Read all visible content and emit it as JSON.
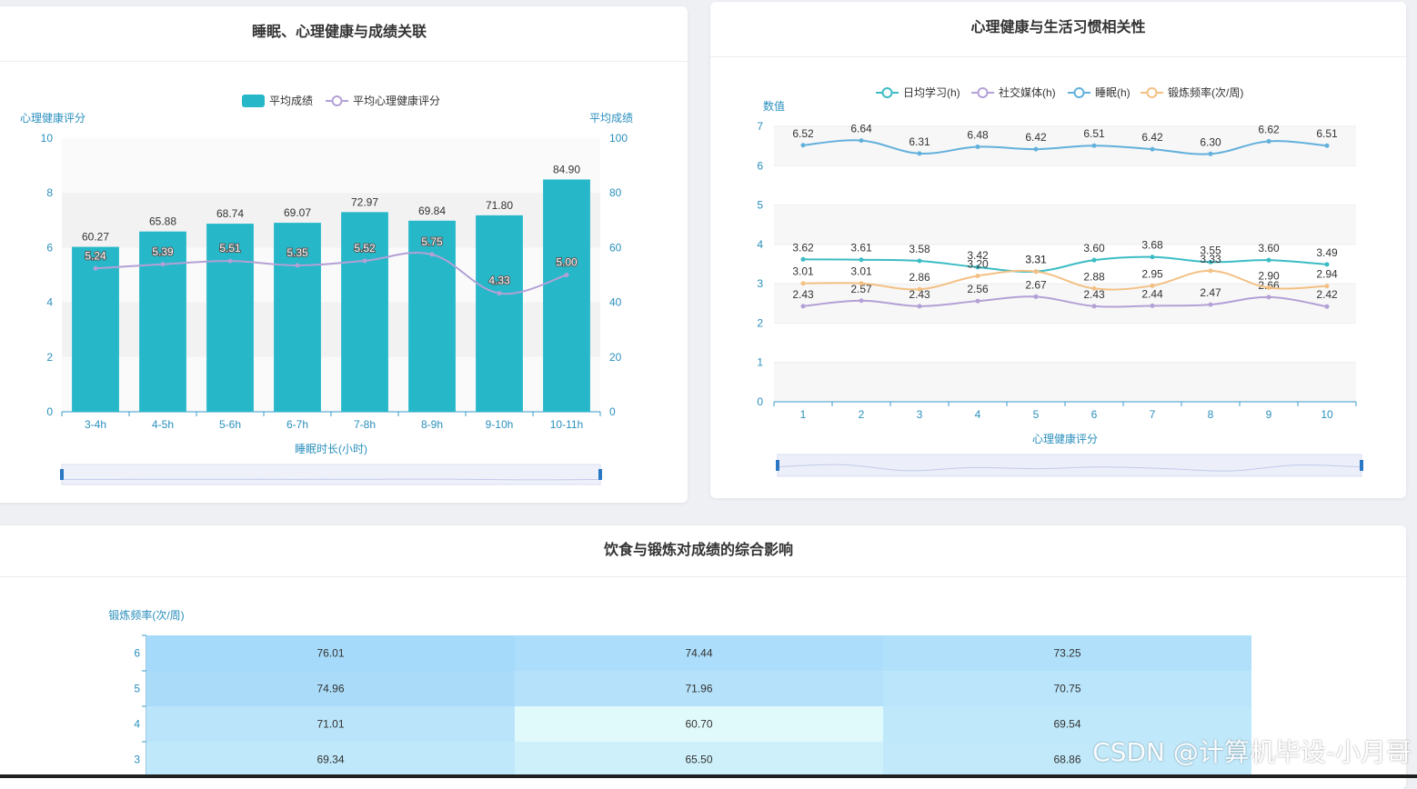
{
  "watermark": "CSDN @计算机毕设-小月哥",
  "chart_data": [
    {
      "type": "bar",
      "title": "睡眠、心理健康与成绩关联",
      "xlabel": "睡眠时长(小时)",
      "ylabel_left": "心理健康评分",
      "ylabel_right": "平均成绩",
      "categories": [
        "3-4h",
        "4-5h",
        "5-6h",
        "6-7h",
        "7-8h",
        "8-9h",
        "9-10h",
        "10-11h"
      ],
      "ylim_left": [
        0,
        10
      ],
      "ylim_right": [
        0,
        100
      ],
      "yticks_left": [
        "0",
        "2",
        "4",
        "6",
        "8",
        "10"
      ],
      "yticks_right": [
        "0",
        "20",
        "40",
        "60",
        "80",
        "100"
      ],
      "legend_position": "top-center",
      "series": [
        {
          "name": "平均成绩",
          "kind": "bar",
          "axis": "right",
          "color": "#26b8c9",
          "values": [
            60.27,
            65.88,
            68.74,
            69.07,
            72.97,
            69.84,
            71.8,
            84.9
          ],
          "labels": [
            "60.27",
            "65.88",
            "68.74",
            "69.07",
            "72.97",
            "69.84",
            "71.80",
            "84.90"
          ]
        },
        {
          "name": "平均心理健康评分",
          "kind": "line",
          "axis": "left",
          "color": "#b3a0d6",
          "values": [
            5.24,
            5.39,
            5.51,
            5.35,
            5.52,
            5.75,
            4.33,
            5.0
          ],
          "labels": [
            "5.24",
            "5.39",
            "5.51",
            "5.35",
            "5.52",
            "5.75",
            "4.33",
            "5.00"
          ]
        }
      ]
    },
    {
      "type": "line",
      "title": "心理健康与生活习惯相关性",
      "xlabel": "心理健康评分",
      "ylabel": "数值",
      "x": [
        "1",
        "2",
        "3",
        "4",
        "5",
        "6",
        "7",
        "8",
        "9",
        "10"
      ],
      "ylim": [
        0,
        7
      ],
      "yticks": [
        "0",
        "1",
        "2",
        "3",
        "4",
        "5",
        "6",
        "7"
      ],
      "legend_position": "top-center",
      "series": [
        {
          "name": "日均学习(h)",
          "color": "#3cbcc4",
          "values": [
            3.62,
            3.61,
            3.58,
            3.42,
            3.31,
            3.6,
            3.68,
            3.55,
            3.6,
            3.49
          ],
          "labels": [
            "3.62",
            "3.61",
            "3.58",
            "3.42",
            "3.31",
            "3.60",
            "3.68",
            "3.55",
            "3.60",
            "3.49"
          ]
        },
        {
          "name": "社交媒体(h)",
          "color": "#b3a0d6",
          "values": [
            2.43,
            2.57,
            2.43,
            2.56,
            2.67,
            2.43,
            2.44,
            2.47,
            2.66,
            2.42
          ],
          "labels": [
            "2.43",
            "2.57",
            "2.43",
            "2.56",
            "2.67",
            "2.43",
            "2.44",
            "2.47",
            "2.66",
            "2.42"
          ]
        },
        {
          "name": "睡眠(h)",
          "color": "#62b0dc",
          "values": [
            6.52,
            6.64,
            6.31,
            6.48,
            6.42,
            6.51,
            6.42,
            6.3,
            6.62,
            6.51
          ],
          "labels": [
            "6.52",
            "6.64",
            "6.31",
            "6.48",
            "6.42",
            "6.51",
            "6.42",
            "6.30",
            "6.62",
            "6.51"
          ]
        },
        {
          "name": "锻炼频率(次/周)",
          "color": "#f3c084",
          "values": [
            3.01,
            3.01,
            2.86,
            3.2,
            3.31,
            2.88,
            2.95,
            3.33,
            2.9,
            2.94
          ],
          "labels": [
            "3.01",
            "3.01",
            "2.86",
            "3.20",
            "3.31",
            "2.88",
            "2.95",
            "3.33",
            "2.90",
            "2.94"
          ]
        }
      ]
    },
    {
      "type": "heatmap",
      "title": "饮食与锻炼对成绩的综合影响",
      "ylabel": "锻炼频率(次/周)",
      "y": [
        "6",
        "5",
        "4",
        "3"
      ],
      "values": [
        [
          76.01,
          74.44,
          73.25
        ],
        [
          74.96,
          71.96,
          70.75
        ],
        [
          71.01,
          60.7,
          69.54
        ],
        [
          69.34,
          65.5,
          68.86
        ]
      ],
      "labels": [
        [
          "76.01",
          "74.44",
          "73.25"
        ],
        [
          "74.96",
          "71.96",
          "70.75"
        ],
        [
          "71.01",
          "60.70",
          "69.54"
        ],
        [
          "69.34",
          "65.50",
          "68.86"
        ]
      ],
      "color_low": "#e0fafb",
      "color_high": "#a6dafa"
    }
  ]
}
